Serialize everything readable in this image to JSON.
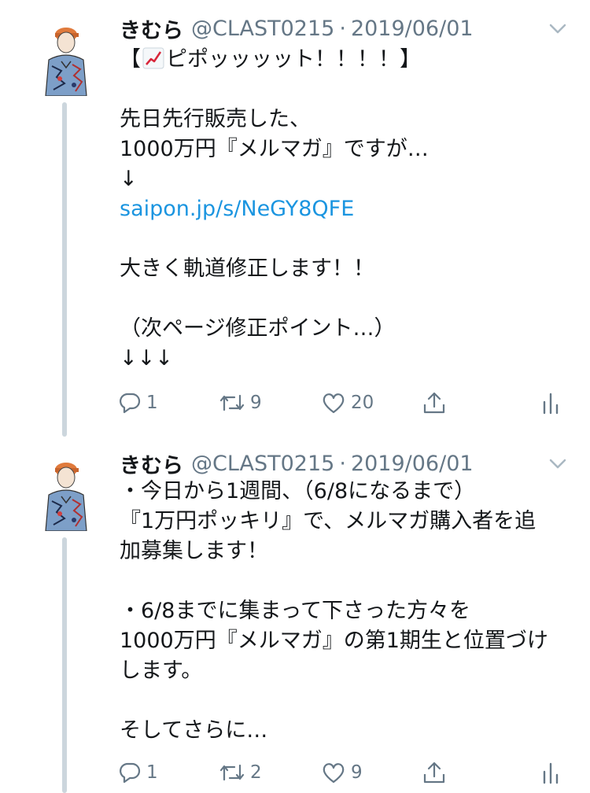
{
  "colors": {
    "text": "#14171a",
    "secondary": "#657786",
    "link": "#1b95e0",
    "thread_line": "#ccd6dd",
    "chart_emoji_line": "#d8263a"
  },
  "tweets": [
    {
      "author_name": "きむら",
      "handle": "@CLAST0215",
      "separator": "·",
      "date": "2019/06/01",
      "lines": [
        {
          "pre": "【",
          "emoji": "chart-increasing-emoji",
          "post": "ピポッッッット！！！！】"
        },
        {
          "text": ""
        },
        {
          "text": "先日先行販売した、"
        },
        {
          "text": "1000万円『メルマガ』ですが…"
        },
        {
          "text": "↓"
        },
        {
          "link": "saipon.jp/s/NeGY8QFE"
        },
        {
          "text": ""
        },
        {
          "text": "大きく軌道修正します！！"
        },
        {
          "text": ""
        },
        {
          "text": "（次ページ修正ポイント…）"
        },
        {
          "text": "↓↓↓"
        }
      ],
      "reply_count": "1",
      "retweet_count": "9",
      "like_count": "20"
    },
    {
      "author_name": "きむら",
      "handle": "@CLAST0215",
      "separator": "·",
      "date": "2019/06/01",
      "lines": [
        {
          "text": "・今日から1週間、（6/8になるまで）"
        },
        {
          "text": "『1万円ポッキリ』で、メルマガ購入者を追"
        },
        {
          "text": "加募集します！"
        },
        {
          "text": ""
        },
        {
          "text": "・6/8までに集まって下さった方々を"
        },
        {
          "text": "1000万円『メルマガ』の第1期生と位置づけ"
        },
        {
          "text": "します。"
        },
        {
          "text": ""
        },
        {
          "text": "そしてさらに…"
        }
      ],
      "reply_count": "1",
      "retweet_count": "2",
      "like_count": "9"
    }
  ]
}
